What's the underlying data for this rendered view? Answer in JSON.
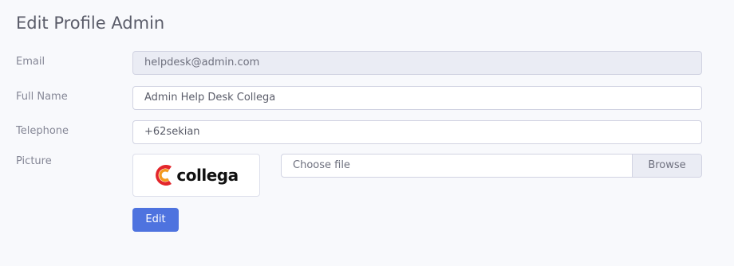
{
  "page": {
    "title": "Edit Profile Admin"
  },
  "form": {
    "email": {
      "label": "Email",
      "value": "helpdesk@admin.com"
    },
    "full_name": {
      "label": "Full Name",
      "value": "Admin Help Desk Collega"
    },
    "telephone": {
      "label": "Telephone",
      "value": "+62sekian"
    },
    "picture": {
      "label": "Picture",
      "logo_text": "collega",
      "file_placeholder": "Choose file",
      "browse_label": "Browse"
    },
    "submit_label": "Edit"
  },
  "colors": {
    "primary": "#4e73df",
    "logo_red": "#e3262b",
    "logo_orange": "#f39a1e"
  }
}
